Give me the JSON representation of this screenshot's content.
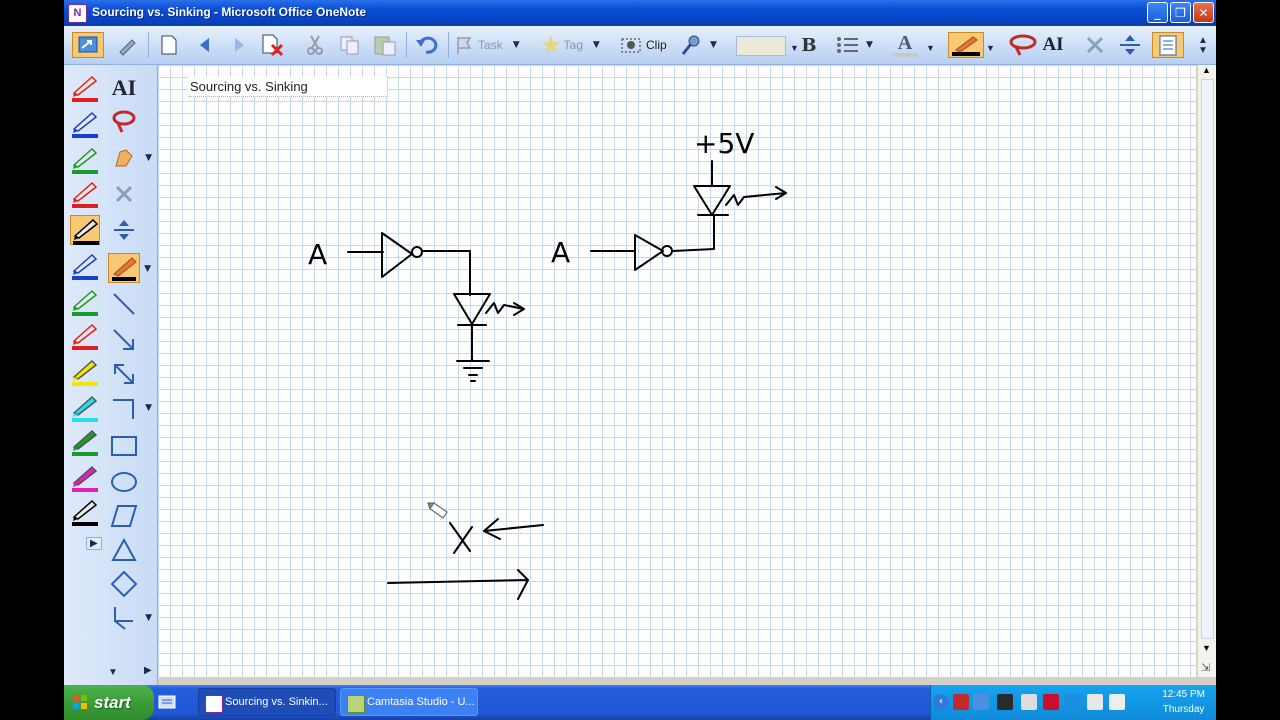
{
  "window": {
    "title": "Sourcing vs. Sinking - Microsoft Office OneNote",
    "controls": [
      "minimize",
      "maximize",
      "close"
    ]
  },
  "toolbar": {
    "task_label": "Task",
    "tag_label": "Tag",
    "clip_label": "Clip",
    "bold_label": "B",
    "text_label": "A"
  },
  "page": {
    "title": "Sourcing vs. Sinking",
    "ink_labels": [
      "A",
      "A",
      "+5V"
    ]
  },
  "taskbar": {
    "start_label": "start",
    "tasks": [
      {
        "label": "Sourcing vs. Sinkin...",
        "active": true
      },
      {
        "label": "Camtasia Studio - U...",
        "active": false
      }
    ],
    "clock_time": "12:45 PM",
    "clock_day": "Thursday"
  },
  "colors": {
    "titlebar": "#0a4fd6",
    "toolbar": "#c8dcf6",
    "grid": "#c6d8ee",
    "taskbar": "#245edb",
    "start": "#379a35",
    "highlight": "#f8c873"
  },
  "icons": {
    "toolbar": [
      "view-icon",
      "pen-tool-icon",
      "new-page-icon",
      "back-icon",
      "forward-icon",
      "delete-icon",
      "cut-icon",
      "copy-icon",
      "paste-icon",
      "undo-icon",
      "task-flag-icon",
      "tag-star-icon",
      "screen-clip-icon",
      "audio-icon",
      "bullets-icon",
      "font-color-icon",
      "pen-icon",
      "lasso-icon",
      "insert-space-icon",
      "eraser-icon",
      "notebook-icon"
    ],
    "pens": [
      "red-pen",
      "blue-pen",
      "green-pen",
      "red-pen",
      "black-pen",
      "blue-pen",
      "green-pen",
      "red-pen",
      "yellow-highlighter",
      "cyan-highlighter",
      "green-highlighter",
      "magenta-highlighter",
      "black-pen"
    ]
  }
}
